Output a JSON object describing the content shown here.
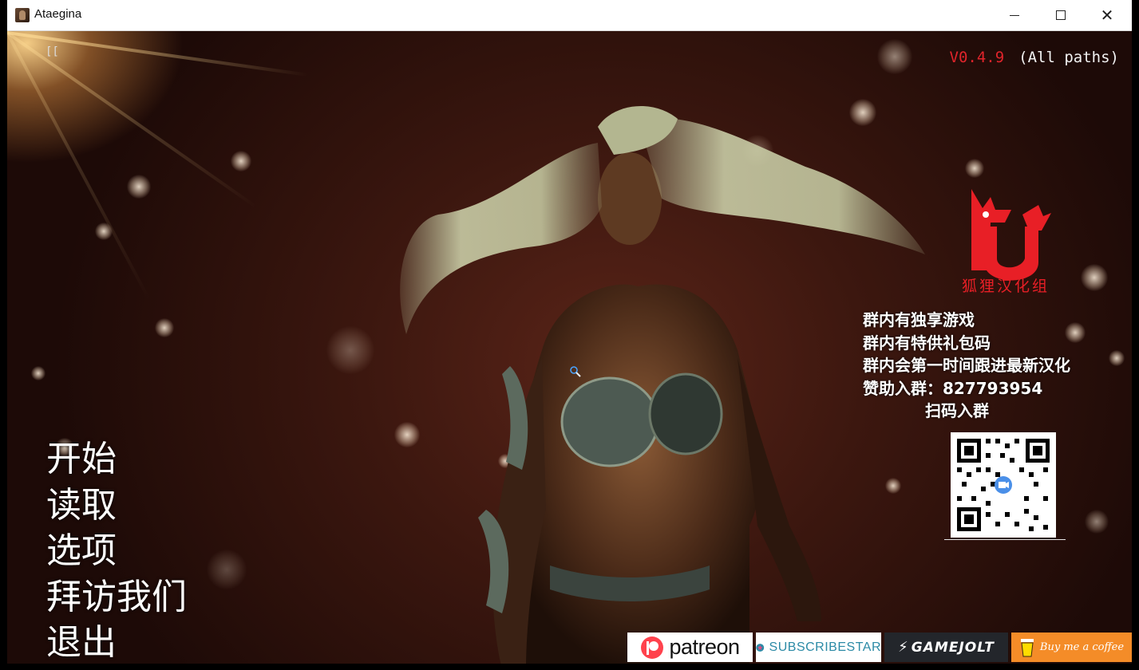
{
  "window": {
    "title": "Ataegina"
  },
  "game": {
    "corner_mark": "[[",
    "version": "V0.4.9",
    "paths": "(All paths)",
    "menu": [
      {
        "label": "开始"
      },
      {
        "label": "读取"
      },
      {
        "label": "选项"
      },
      {
        "label": "拜访我们"
      },
      {
        "label": "退出"
      }
    ],
    "group": {
      "name": "狐狸汉化组",
      "lines": [
        "群内有独享游戏",
        "群内有特供礼包码",
        "群内会第一时间跟进最新汉化",
        "赞助入群：827793954"
      ],
      "scan": "扫码入群"
    },
    "badges": {
      "patreon": "patreon",
      "subscribestar": "SUBSCRIBESTAR",
      "gamejolt": "GAMEJOLT",
      "coffee": "Buy me a coffee"
    }
  },
  "colors": {
    "version": "#e0242b",
    "logo": "#e81f26",
    "patreon": "#ff424d",
    "subscribestar": "#2b8aa6",
    "coffee": "#f48c28"
  }
}
